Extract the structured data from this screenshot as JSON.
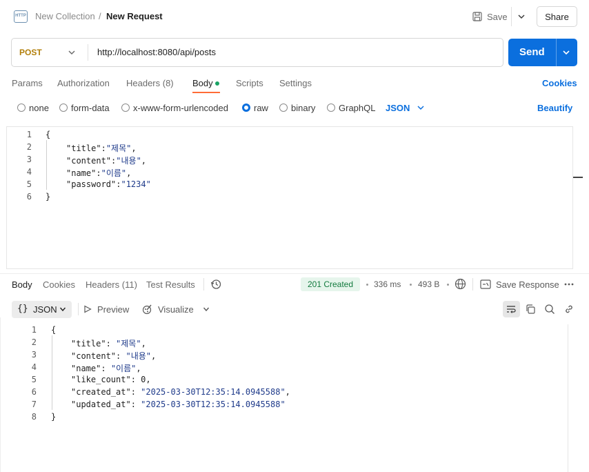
{
  "header": {
    "icon_text": "HTTP",
    "collection": "New Collection",
    "separator": "/",
    "request_name": "New Request",
    "save_label": "Save",
    "share_label": "Share"
  },
  "request": {
    "method": "POST",
    "url": "http://localhost:8080/api/posts",
    "send_label": "Send"
  },
  "request_tabs": [
    {
      "label": "Params"
    },
    {
      "label": "Authorization"
    },
    {
      "label": "Headers (8)"
    },
    {
      "label": "Body"
    },
    {
      "label": "Scripts"
    },
    {
      "label": "Settings"
    }
  ],
  "cookies_label": "Cookies",
  "body_types": [
    {
      "label": "none",
      "checked": false
    },
    {
      "label": "form-data",
      "checked": false
    },
    {
      "label": "x-www-form-urlencoded",
      "checked": false
    },
    {
      "label": "raw",
      "checked": true
    },
    {
      "label": "binary",
      "checked": false
    },
    {
      "label": "GraphQL",
      "checked": false
    }
  ],
  "raw_format": "JSON",
  "beautify_label": "Beautify",
  "request_body": [
    {
      "n": "1",
      "indent": 0,
      "key": "",
      "val": "",
      "text": "{"
    },
    {
      "n": "2",
      "indent": 1,
      "key": "\"title\"",
      "sep": ":",
      "val": "\"제목\"",
      "tail": ","
    },
    {
      "n": "3",
      "indent": 1,
      "key": "\"content\"",
      "sep": ":",
      "val": "\"내용\"",
      "tail": ","
    },
    {
      "n": "4",
      "indent": 1,
      "key": "\"name\"",
      "sep": ":",
      "val": "\"이름\"",
      "tail": ","
    },
    {
      "n": "5",
      "indent": 1,
      "key": "\"password\"",
      "sep": ":",
      "val": "\"1234\"",
      "tail": ""
    },
    {
      "n": "6",
      "indent": 0,
      "key": "",
      "val": "",
      "text": "}"
    }
  ],
  "response_tabs": [
    {
      "label": "Body"
    },
    {
      "label": "Cookies"
    },
    {
      "label": "Headers (11)"
    },
    {
      "label": "Test Results"
    }
  ],
  "response_meta": {
    "status": "201 Created",
    "time": "336 ms",
    "size": "493 B",
    "save_response_label": "Save Response"
  },
  "response_view": {
    "braces": "{}",
    "format": "JSON",
    "preview_label": "Preview",
    "visualize_label": "Visualize"
  },
  "response_body": [
    {
      "n": "1",
      "indent": 0,
      "text": "{"
    },
    {
      "n": "2",
      "indent": 1,
      "key": "\"title\"",
      "sep": ": ",
      "val": "\"제목\"",
      "tail": ","
    },
    {
      "n": "3",
      "indent": 1,
      "key": "\"content\"",
      "sep": ": ",
      "val": "\"내용\"",
      "tail": ","
    },
    {
      "n": "4",
      "indent": 1,
      "key": "\"name\"",
      "sep": ": ",
      "val": "\"이름\"",
      "tail": ","
    },
    {
      "n": "5",
      "indent": 1,
      "key": "\"like_count\"",
      "sep": ": ",
      "val": "0",
      "tail": ","
    },
    {
      "n": "6",
      "indent": 1,
      "key": "\"created_at\"",
      "sep": ": ",
      "val": "\"2025-03-30T12:35:14.0945588\"",
      "tail": ","
    },
    {
      "n": "7",
      "indent": 1,
      "key": "\"updated_at\"",
      "sep": ": ",
      "val": "\"2025-03-30T12:35:14.0945588\"",
      "tail": ""
    },
    {
      "n": "8",
      "indent": 0,
      "text": "}"
    }
  ],
  "colors": {
    "accent": "#0b6fde",
    "method": "#b27f0a",
    "tab_underline": "#ff6c37",
    "status_bg": "#e6f5ec",
    "status_fg": "#127a3e"
  }
}
